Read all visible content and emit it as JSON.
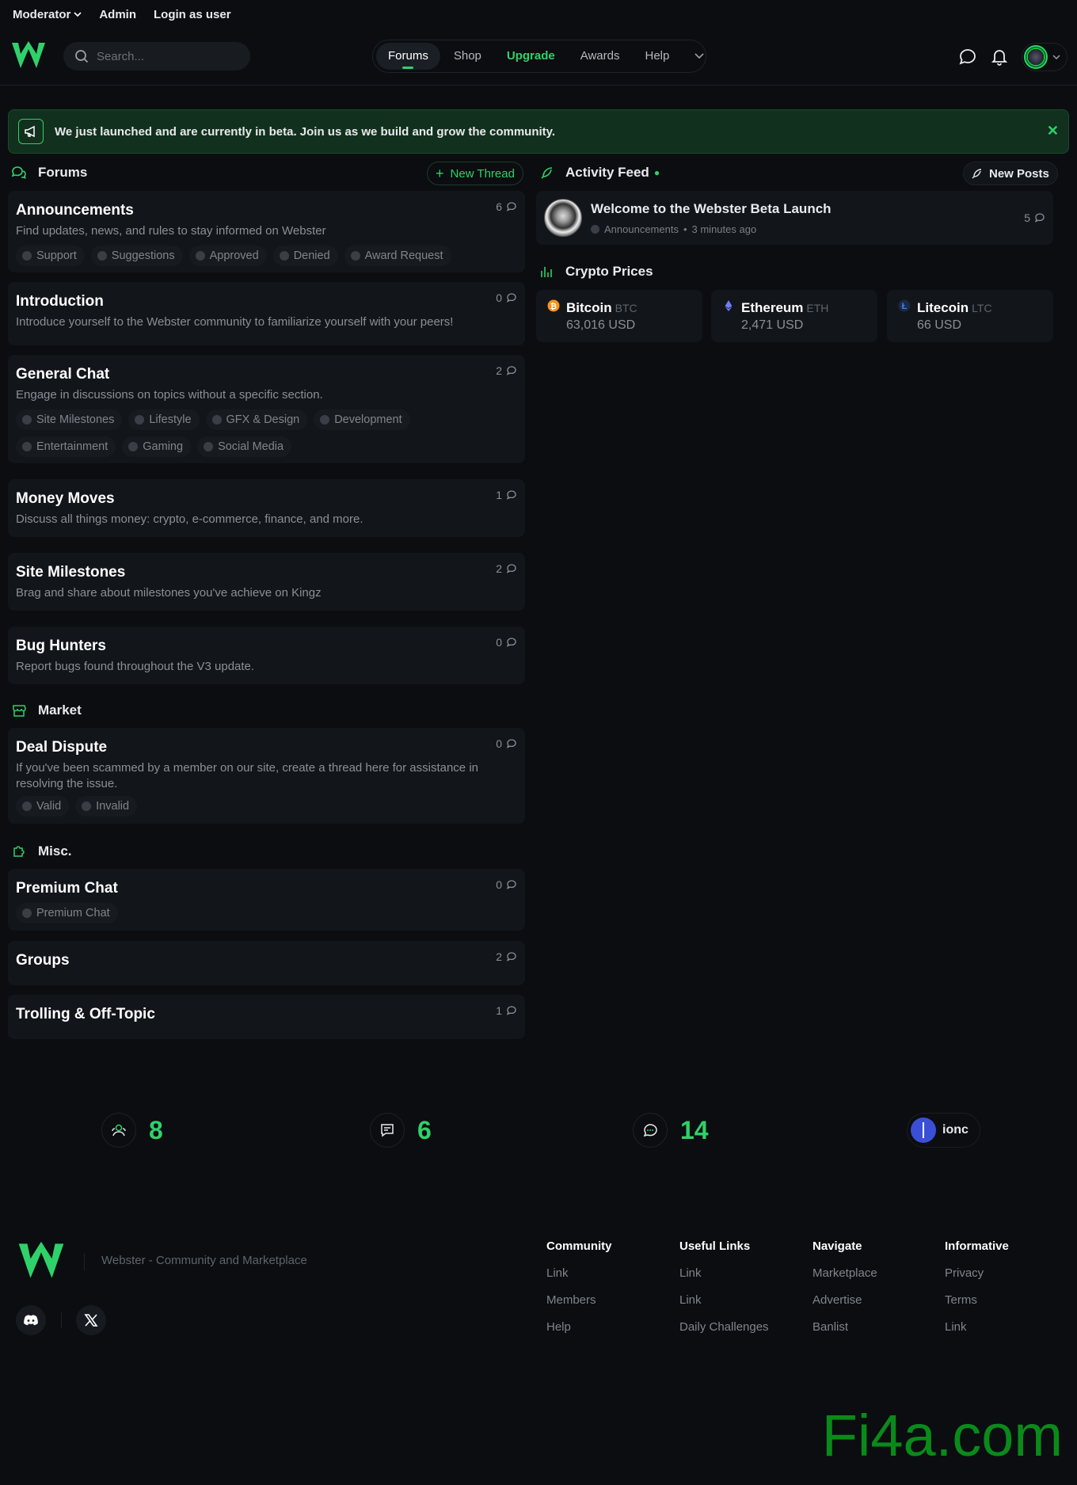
{
  "topbar": {
    "moderator": "Moderator",
    "admin": "Admin",
    "login_as_user": "Login as user"
  },
  "header": {
    "search_placeholder": "Search...",
    "nav": [
      "Forums",
      "Shop",
      "Upgrade",
      "Awards",
      "Help"
    ]
  },
  "banner": {
    "text": "We just launched and are currently in beta. Join us as we build and grow the community."
  },
  "forums": {
    "heading": "Forums",
    "new_thread": "New Thread",
    "categories": [
      {
        "title": "Announcements",
        "desc": "Find updates, news, and rules to stay informed on Webster",
        "count": "6",
        "tags": [
          "Support",
          "Suggestions",
          "Approved",
          "Denied",
          "Award Request"
        ]
      },
      {
        "title": "Introduction",
        "desc": "Introduce yourself to the Webster community to familiarize yourself with your peers!",
        "count": "0",
        "tags": []
      },
      {
        "title": "General Chat",
        "desc": "Engage in discussions on topics without a specific section.",
        "count": "2",
        "tags": [
          "Site Milestones",
          "Lifestyle",
          "GFX & Design",
          "Development",
          "Entertainment",
          "Gaming",
          "Social Media"
        ]
      },
      {
        "title": "Money Moves",
        "desc": "Discuss all things money: crypto, e-commerce, finance, and more.",
        "count": "1",
        "tags": []
      },
      {
        "title": "Site Milestones",
        "desc": "Brag and share about milestones you've achieve on Kingz",
        "count": "2",
        "tags": []
      },
      {
        "title": "Bug Hunters",
        "desc": "Report bugs found throughout the V3 update.",
        "count": "0",
        "tags": []
      }
    ]
  },
  "market": {
    "heading": "Market",
    "categories": [
      {
        "title": "Deal Dispute",
        "desc1": "If you've been scammed by a member on our site, create a thread here for assistance in",
        "desc2": "resolving the issue.",
        "count": "0",
        "tags": [
          "Valid",
          "Invalid"
        ]
      }
    ]
  },
  "misc": {
    "heading": "Misc.",
    "categories": [
      {
        "title": "Premium Chat",
        "count": "0",
        "tags": [
          "Premium Chat"
        ]
      },
      {
        "title": "Groups",
        "count": "2",
        "tags": []
      },
      {
        "title": "Trolling & Off-Topic",
        "count": "1",
        "tags": []
      }
    ]
  },
  "activity": {
    "heading": "Activity Feed",
    "new_posts": "New Posts",
    "item": {
      "title": "Welcome to the Webster Beta Launch",
      "forum": "Announcements",
      "time": "3 minutes ago",
      "count": "5"
    }
  },
  "crypto": {
    "heading": "Crypto Prices",
    "coins": [
      {
        "name": "Bitcoin",
        "symbol": "BTC",
        "price": "63,016 USD",
        "color": "#f7931a"
      },
      {
        "name": "Ethereum",
        "symbol": "ETH",
        "price": "2,471 USD",
        "color": "#6f7cf6"
      },
      {
        "name": "Litecoin",
        "symbol": "LTC",
        "price": "66 USD",
        "color": "#3b82f6"
      }
    ]
  },
  "stats": {
    "members": "8",
    "threads": "6",
    "posts": "14",
    "latest_user": "ionc"
  },
  "footer": {
    "tagline": "Webster - Community and Marketplace",
    "columns": [
      {
        "heading": "Community",
        "links": [
          "Link",
          "Members",
          "Help"
        ]
      },
      {
        "heading": "Useful Links",
        "links": [
          "Link",
          "Link",
          "Daily Challenges"
        ]
      },
      {
        "heading": "Navigate",
        "links": [
          "Marketplace",
          "Advertise",
          "Banlist"
        ]
      },
      {
        "heading": "Informative",
        "links": [
          "Privacy",
          "Terms",
          "Link"
        ]
      }
    ]
  },
  "watermark": "Fi4a.com",
  "colors": {
    "accent": "#2fd16a",
    "background": "#0b0d10",
    "card": "#12151a"
  }
}
